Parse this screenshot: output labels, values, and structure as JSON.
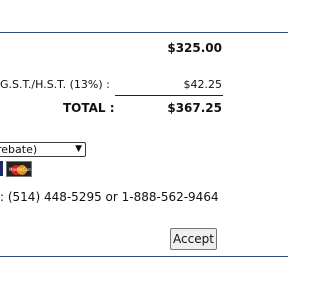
{
  "summary": {
    "subtotal_value": "$325.00",
    "tax_label": "G.S.T./H.S.T. (13%) :",
    "tax_value": "$42.25",
    "total_label": "TOTAL :",
    "total_value": "$367.25"
  },
  "options": {
    "selected_option": "rebate)"
  },
  "payment": {
    "mastercard_label": "MasterCard"
  },
  "contact": {
    "phone_text": ": (514) 448-5295 or 1-888-562-9464"
  },
  "actions": {
    "accept_label": "Accept"
  },
  "colors": {
    "rule": "#2e4a8a",
    "button_bg": "#efefef"
  }
}
